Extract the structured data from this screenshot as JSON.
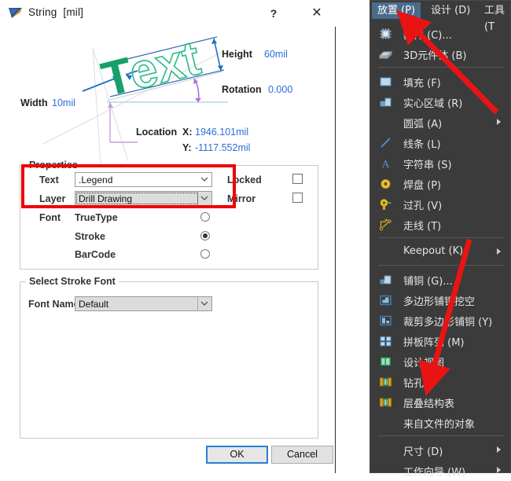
{
  "dialog": {
    "title": "String",
    "unit": "[mil]",
    "icon": "altium-flag-icon",
    "help_label": "?",
    "close_label": "✕",
    "preview": {
      "text_sample": "Text",
      "height_label": "Height",
      "height_value": "60mil",
      "rotation_label": "Rotation",
      "rotation_value": "0.000",
      "width_label": "Width",
      "width_value": "10mil",
      "location_label": "Location",
      "x_label": "X:",
      "x_value": "1946.101mil",
      "y_label": "Y:",
      "y_value": "-1117.552mil"
    },
    "properties": {
      "group_title": "Properties",
      "text_label": "Text",
      "text_value": ".Legend",
      "layer_label": "Layer",
      "layer_value": "Drill Drawing",
      "locked_label": "Locked",
      "locked_checked": false,
      "mirror_label": "Mirror",
      "mirror_checked": false,
      "font_label": "Font",
      "font_options": [
        {
          "label": "TrueType",
          "selected": false
        },
        {
          "label": "Stroke",
          "selected": true
        },
        {
          "label": "BarCode",
          "selected": false
        }
      ]
    },
    "stroke_font": {
      "group_title": "Select Stroke Font",
      "font_name_label": "Font Name",
      "font_name_value": "Default"
    },
    "buttons": {
      "ok": "OK",
      "cancel": "Cancel"
    }
  },
  "menu": {
    "bar": [
      {
        "label": "放置 (P)",
        "active": true
      },
      {
        "label": "设计 (D)",
        "active": false
      },
      {
        "label": "工具 (T",
        "active": false
      }
    ],
    "items": [
      {
        "label": "器件 (C)...",
        "icon": "chip-icon",
        "submenu": false,
        "sep_after": false
      },
      {
        "label": "3D元件体 (B)",
        "icon": "3d-body-icon",
        "submenu": false,
        "sep_after": true
      },
      {
        "label": "填充 (F)",
        "icon": "fill-icon",
        "submenu": false,
        "sep_after": false
      },
      {
        "label": "实心区域 (R)",
        "icon": "solid-region-icon",
        "submenu": false,
        "sep_after": false
      },
      {
        "label": "圆弧 (A)",
        "icon": "none",
        "submenu": true,
        "sep_after": false
      },
      {
        "label": "线条 (L)",
        "icon": "line-icon",
        "submenu": false,
        "sep_after": false
      },
      {
        "label": "字符串 (S)",
        "icon": "string-icon",
        "submenu": false,
        "sep_after": false
      },
      {
        "label": "焊盘 (P)",
        "icon": "pad-icon",
        "submenu": false,
        "sep_after": false
      },
      {
        "label": "过孔 (V)",
        "icon": "via-icon",
        "submenu": false,
        "sep_after": false
      },
      {
        "label": "走线 (T)",
        "icon": "track-icon",
        "submenu": false,
        "sep_after": true
      },
      {
        "label": "Keepout (K)",
        "icon": "none",
        "submenu": true,
        "sep_after": true
      },
      {
        "label": "铺铜 (G)...",
        "icon": "polygon-pour-icon",
        "submenu": false,
        "sep_after": false
      },
      {
        "label": "多边形铺铜挖空",
        "icon": "polygon-cutout-icon",
        "submenu": false,
        "sep_after": false
      },
      {
        "label": "裁剪多边形铺铜 (Y)",
        "icon": "polygon-slice-icon",
        "submenu": false,
        "sep_after": false
      },
      {
        "label": "拼板阵列 (M)",
        "icon": "panel-array-icon",
        "submenu": false,
        "sep_after": false
      },
      {
        "label": "设计视图",
        "icon": "design-view-icon",
        "submenu": false,
        "sep_after": false
      },
      {
        "label": "钻孔表",
        "icon": "drill-table-icon",
        "submenu": false,
        "sep_after": false
      },
      {
        "label": "层叠结构表",
        "icon": "layer-stack-icon",
        "submenu": false,
        "sep_after": false
      },
      {
        "label": "来自文件的对象",
        "icon": "none",
        "submenu": false,
        "sep_after": true
      },
      {
        "label": "尺寸 (D)",
        "icon": "none",
        "submenu": true,
        "sep_after": false
      },
      {
        "label": "工作向导 (W)",
        "icon": "none",
        "submenu": true,
        "sep_after": false
      }
    ]
  },
  "annotations": {
    "highlight_color": "#f00000",
    "arrow_color": "#e81414",
    "arrow_count": 2
  }
}
